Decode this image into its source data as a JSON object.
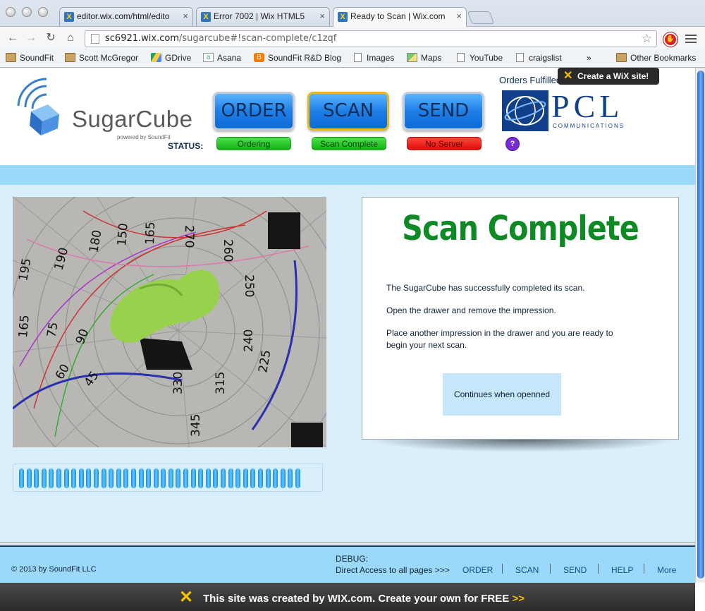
{
  "browser": {
    "tabs": [
      {
        "title": "editor.wix.com/html/edito",
        "active": false
      },
      {
        "title": "Error 7002 | Wix HTML5",
        "active": false
      },
      {
        "title": "Ready to Scan | Wix.com",
        "active": true
      }
    ],
    "url_host": "sc6921.wix.com",
    "url_path": "/sugarcube#!scan-complete/c1zqf",
    "bookmarks": [
      "SoundFit",
      "Scott McGregor",
      "GDrive",
      "Asana",
      "SoundFit R&D Blog",
      "Images",
      "Maps",
      "YouTube",
      "craigslist"
    ],
    "bookmarks_more": "»",
    "other_bookmarks": "Other Bookmarks"
  },
  "header": {
    "logo_text": "SugarCube",
    "logo_sub": "powered by SoundFit",
    "nav": {
      "order": "ORDER",
      "scan": "SCAN",
      "send": "SEND"
    },
    "status_label": "STATUS:",
    "status": {
      "order": "Ordering",
      "scan": "Scan Complete",
      "send": "No Server"
    },
    "help": "?",
    "orders_fulfilled": "Orders Fulfilled",
    "pcl": "PCL",
    "pcl_sub": "COMMUNICATIONS",
    "wix_tooltip": "Create a WiX site!"
  },
  "main": {
    "title": "Scan Complete",
    "p1": "The SugarCube has successfully completed its scan.",
    "p2": "Open the drawer and remove the impression.",
    "p3": "Place another impression in the drawer and you are ready to begin your next scan.",
    "continue": "Continues when openned",
    "progress_fraction": 1.0
  },
  "footer": {
    "copyright": "© 2013 by SoundFit LLC",
    "debug": "DEBUG:",
    "direct": "Direct Access to all pages  >>>",
    "links": [
      "ORDER",
      "SCAN",
      "SEND",
      "HELP",
      "More"
    ]
  },
  "wixbar": {
    "text": "This site was created by WIX.com. Create your own for FREE",
    "arrows": ">>"
  },
  "colors": {
    "accent_blue": "#1e7fe6",
    "status_green": "#10b310",
    "status_red": "#dd0a0a",
    "title_green": "#0d8a24",
    "band_blue": "#9ad9fb"
  }
}
